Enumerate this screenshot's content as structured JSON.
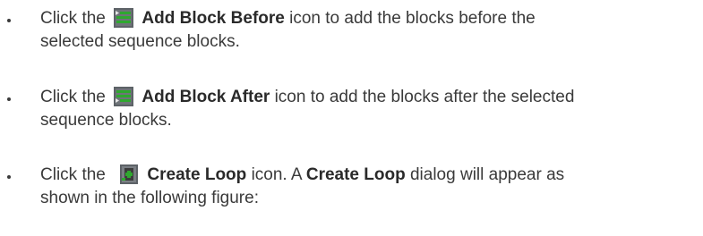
{
  "items": [
    {
      "prefix": "Click the",
      "bold": "Add Block Before",
      "suffix_line1": "icon to add the blocks before the",
      "suffix_line2": "selected sequence blocks.",
      "icon": "add-block-before-icon"
    },
    {
      "prefix": "Click the",
      "bold": "Add Block After",
      "suffix_line1": "icon to add the blocks after the selected",
      "suffix_line2": "sequence blocks.",
      "icon": "add-block-after-icon"
    },
    {
      "prefix": "Click the",
      "bold": "Create Loop",
      "mid": "icon. A",
      "bold2": "Create Loop",
      "suffix_line1": "dialog will appear as",
      "suffix_line2": "shown in the following figure:",
      "icon": "create-loop-icon"
    }
  ],
  "colors": {
    "icon_green": "#2fa82f",
    "icon_dark": "#3c3c3c",
    "icon_gray": "#6e7276"
  }
}
